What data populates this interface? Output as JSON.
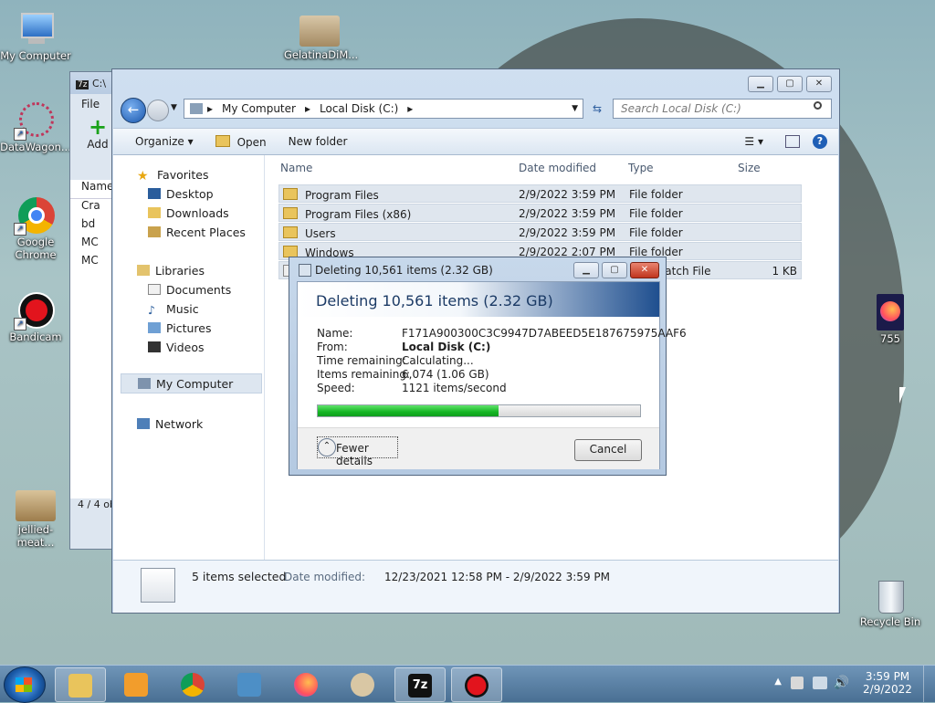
{
  "desktop": {
    "icons": [
      {
        "label": "My Computer",
        "icon": "computer-icon"
      },
      {
        "label": "GelatinaDiM...",
        "icon": "image-thumbnail-icon"
      },
      {
        "label": "DataWagon...",
        "icon": "datawagon-icon"
      },
      {
        "label": "Google Chrome",
        "icon": "chrome-icon"
      },
      {
        "label": "Bandicam",
        "icon": "bandicam-icon"
      },
      {
        "label": "755",
        "icon": "firefox-file-icon"
      },
      {
        "label": "jellied-meat...",
        "icon": "image-thumbnail-icon"
      },
      {
        "label": "Recycle Bin",
        "icon": "recycle-bin-icon"
      }
    ]
  },
  "sevenzip": {
    "title": "C:\\",
    "menu_file": "File",
    "add_label": "Add",
    "col_name": "Name",
    "rows": [
      "Cra",
      "bd",
      "MC",
      "MC"
    ],
    "status": "4 / 4 ob"
  },
  "explorer": {
    "breadcrumb": [
      "My Computer",
      "Local Disk (C:)"
    ],
    "search_placeholder": "Search Local Disk (C:)",
    "toolbar": {
      "organize": "Organize",
      "open": "Open",
      "new_folder": "New folder"
    },
    "nav": {
      "favorites": "Favorites",
      "desktop": "Desktop",
      "downloads": "Downloads",
      "recent": "Recent Places",
      "libraries": "Libraries",
      "documents": "Documents",
      "music": "Music",
      "pictures": "Pictures",
      "videos": "Videos",
      "my_computer": "My Computer",
      "network": "Network"
    },
    "columns": {
      "name": "Name",
      "date": "Date modified",
      "type": "Type",
      "size": "Size"
    },
    "files": [
      {
        "name": "Program Files",
        "date": "2/9/2022 3:59 PM",
        "type": "File folder",
        "size": ""
      },
      {
        "name": "Program Files (x86)",
        "date": "2/9/2022 3:59 PM",
        "type": "File folder",
        "size": ""
      },
      {
        "name": "Users",
        "date": "2/9/2022 3:59 PM",
        "type": "File folder",
        "size": ""
      },
      {
        "name": "Windows",
        "date": "2/9/2022 2:07 PM",
        "type": "File folder",
        "size": ""
      },
      {
        "name": "",
        "date": "",
        "type": "s Batch File",
        "size": "1 KB"
      }
    ],
    "details": {
      "selected": "5 items selected",
      "date_label": "Date modified:",
      "date_range": "12/23/2021 12:58 PM - 2/9/2022 3:59 PM"
    }
  },
  "dialog": {
    "title": "Deleting 10,561 items (2.32 GB)",
    "heading": "Deleting 10,561 items (2.32 GB)",
    "name_label": "Name:",
    "name_value": "F171A900300C3C9947D7ABEED5E187675975AAF6",
    "from_label": "From:",
    "from_value": "Local Disk (C:)",
    "time_label": "Time remaining:",
    "time_value": "Calculating...",
    "items_label": "Items remaining:",
    "items_value": "6,074 (1.06 GB)",
    "speed_label": "Speed:",
    "speed_value": "1121 items/second",
    "progress": 0.56,
    "fewer_details": "Fewer details",
    "cancel": "Cancel"
  },
  "tray": {
    "time": "3:59 PM",
    "date": "2/9/2022"
  }
}
